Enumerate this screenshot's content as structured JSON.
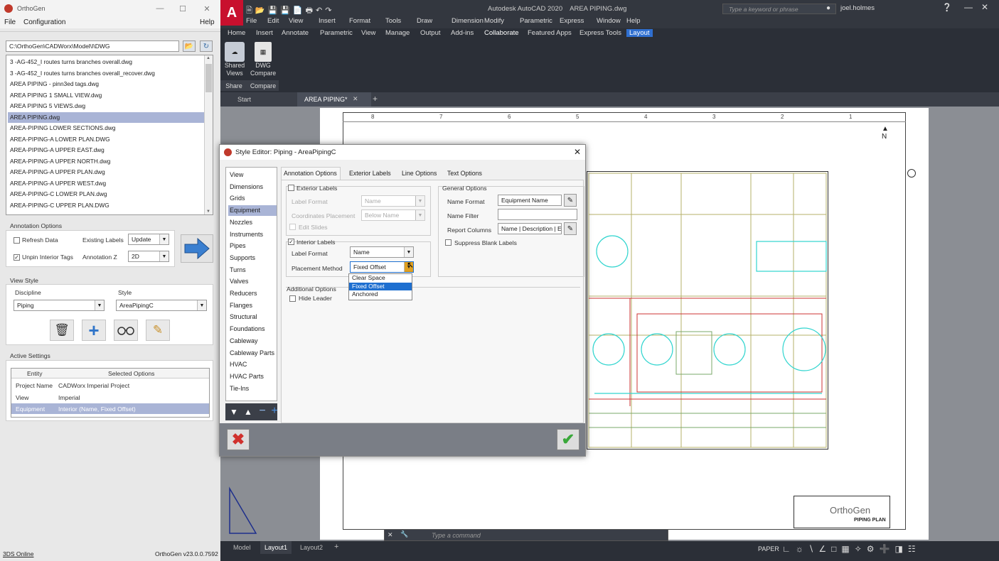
{
  "orthogen": {
    "title": "OrthoGen",
    "menu": {
      "file": "File",
      "config": "Configuration",
      "help": "Help"
    },
    "path": "C:\\OrthoGen\\CADWorx\\Model\\I\\DWG",
    "files": [
      "3 -AG-452_I routes turns branches overall.dwg",
      "3 -AG-452_I routes turns branches overall_recover.dwg",
      "AREA PIPING - pinn3ed tags.dwg",
      "AREA PIPING 1 SMALL VIEW.dwg",
      "AREA PIPING 5 VIEWS.dwg",
      "AREA PIPING.dwg",
      "AREA-PIPING LOWER SECTIONS.dwg",
      "AREA-PIPING-A LOWER PLAN.DWG",
      "AREA-PIPING-A UPPER EAST.dwg",
      "AREA-PIPING-A UPPER NORTH.dwg",
      "AREA-PIPING-A UPPER PLAN.dwg",
      "AREA-PIPING-A UPPER WEST.dwg",
      "AREA-PIPING-C LOWER PLAN.dwg",
      "AREA-PIPING-C UPPER PLAN.DWG"
    ],
    "selected_file_index": 5,
    "annotation": {
      "title": "Annotation Options",
      "refresh": "Refresh Data",
      "unpin": "Unpin Interior Tags",
      "existing_label": "Existing Labels",
      "existing_value": "Update",
      "z_label": "Annotation Z",
      "z_value": "2D"
    },
    "view_style": {
      "title": "View Style",
      "discipline_label": "Discipline",
      "discipline_value": "Piping",
      "style_label": "Style",
      "style_value": "AreaPipingC"
    },
    "active": {
      "title": "Active Settings",
      "col1": "Entity",
      "col2": "Selected Options",
      "rows": [
        {
          "entity": "Project Name",
          "value": "CADWorx Imperial Project"
        },
        {
          "entity": "View",
          "value": "Imperial"
        },
        {
          "entity": "Equipment",
          "value": "Interior (Name, Fixed Offset)"
        }
      ]
    },
    "status_left": "3DS Online",
    "status_right": "OrthoGen v23.0.0.7592"
  },
  "acad": {
    "title": "Autodesk AutoCAD 2020    AREA PIPING.dwg",
    "search_placeholder": "Type a keyword or phrase",
    "user": "joel.holmes",
    "menu": [
      "File",
      "Edit",
      "View",
      "Insert",
      "Format",
      "Tools",
      "Draw",
      "Dimension",
      "Modify",
      "Parametric",
      "Express",
      "Window",
      "Help"
    ],
    "ribbon_tabs": [
      "Home",
      "Insert",
      "Annotate",
      "Parametric",
      "View",
      "Manage",
      "Output",
      "Add-ins",
      "Collaborate",
      "Featured Apps",
      "Express Tools",
      "Layout"
    ],
    "ribbon": {
      "shared_views": "Shared Views",
      "dwg_compare": "DWG Compare",
      "share": "Share",
      "compare": "Compare"
    },
    "doc_tabs": {
      "start": "Start",
      "current": "AREA PIPING*"
    },
    "ruler": [
      "8",
      "7",
      "6",
      "5",
      "4",
      "3",
      "2",
      "1"
    ],
    "command_placeholder": "Type a command",
    "layouts": [
      "Model",
      "Layout1",
      "Layout2"
    ],
    "paper": "PAPER",
    "titleblock_logo": "OrthoGen",
    "titleblock_title": "PIPING PLAN"
  },
  "dialog": {
    "title": "Style Editor: Piping - AreaPipingC",
    "categories": [
      "View",
      "Dimensions",
      "Grids",
      "Equipment",
      "Nozzles",
      "Instruments",
      "Pipes",
      "Supports",
      "Turns",
      "Valves",
      "Reducers",
      "Flanges",
      "Structural",
      "Foundations",
      "Cableway",
      "Cableway Parts",
      "HVAC",
      "HVAC Parts",
      "Tie-Ins"
    ],
    "selected_category_index": 3,
    "tabs": [
      "Annotation Options",
      "Exterior Labels",
      "Line Options",
      "Text Options"
    ],
    "exterior": {
      "title": "Exterior Labels",
      "label_format": "Label Format",
      "label_format_value": "Name",
      "coord_placement": "Coordinates Placement",
      "coord_value": "Below Name",
      "edit_slides": "Edit Slides"
    },
    "interior": {
      "title": "Interior Labels",
      "label_format": "Label Format",
      "label_format_value": "Name",
      "placement": "Placement Method",
      "placement_value": "Fixed Offset",
      "options": [
        "Clear Space",
        "Fixed Offset",
        "Anchored"
      ]
    },
    "additional": {
      "title": "Additional Options",
      "hide_leader": "Hide Leader"
    },
    "general": {
      "title": "General Options",
      "name_format": "Name Format",
      "name_format_value": "Equipment Name",
      "name_filter": "Name Filter",
      "name_filter_value": "",
      "report_columns": "Report Columns",
      "report_columns_value": "Name | Description | E",
      "suppress": "Suppress Blank Labels"
    }
  }
}
